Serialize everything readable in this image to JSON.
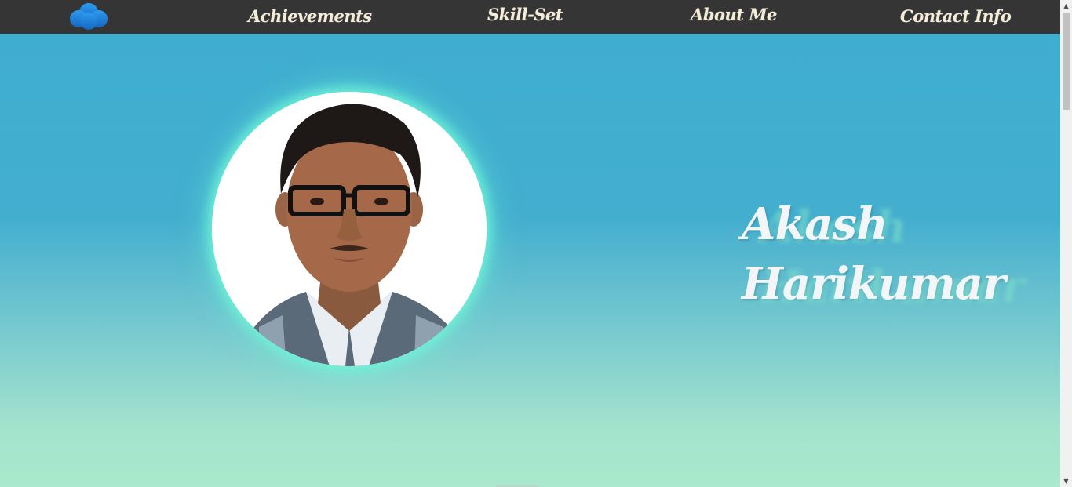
{
  "nav": {
    "logo_icon": "cloud-icon",
    "logo_color": "#1e88e5",
    "background": "#353535",
    "text_color": "#f4ecd8",
    "links": [
      {
        "label": "Achievements"
      },
      {
        "label": "Skill-Set"
      },
      {
        "label": "About Me"
      },
      {
        "label": "Contact Info"
      }
    ]
  },
  "hero": {
    "photo_icon": "profile-photo",
    "glow_color": "#6ef5d7",
    "name_first": "Akash",
    "name_last": "Harikumar"
  },
  "theme": {
    "gradient_top": "#3eadd0",
    "gradient_bottom": "#aae9cd"
  },
  "scrollbar": {
    "up_arrow": "▲",
    "down_arrow": "▼"
  }
}
